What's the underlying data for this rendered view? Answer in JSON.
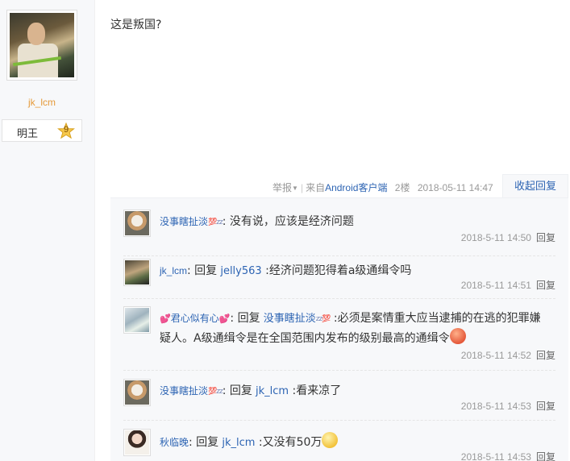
{
  "author": {
    "avatar_icon": "avatar-warrior",
    "name": "jk_lcm",
    "rank_title": "明王",
    "level": "9",
    "name_color": "#e59a3a"
  },
  "post": {
    "content": "这是叛国?"
  },
  "tail": {
    "report_label": "举报",
    "source_prefix": "来自",
    "source_link": "Android客户端",
    "floor": "2楼",
    "time": "2018-05-11 14:47",
    "collapse_label": "收起回复"
  },
  "replies": [
    {
      "user": "没事瞎扯淡",
      "user_badges": [
        "💯",
        "zz"
      ],
      "avatar_icon": "cat-avatar",
      "segments": [
        {
          "type": "text",
          "value": ": 没有说，应该是经济问题"
        }
      ],
      "time": "2018-5-11 14:50",
      "reply_label": "回复"
    },
    {
      "user": "jk_lcm",
      "avatar_icon": "warrior-avatar",
      "prefix": ": 回复",
      "mention": "jelly563",
      "body": " :经济问题犯得着a级通缉令吗",
      "time": "2018-5-11 14:51",
      "reply_label": "回复"
    },
    {
      "user": "君心似有心",
      "avatar_icon": "girl-avatar",
      "prefix": ": 回复",
      "mention": "没事瞎扯淡",
      "body_line1": " :必须是案情重大应当逮捕的在逃的犯罪嫌",
      "body_line2": "疑人。A级通缉令是在全国范围内发布的级别最高的通缉令",
      "time": "2018-5-11 14:52",
      "reply_label": "回复"
    },
    {
      "user": "没事瞎扯淡",
      "avatar_icon": "cat-avatar",
      "prefix": ": 回复",
      "mention": "jk_lcm",
      "body": " :看来凉了",
      "time": "2018-5-11 14:53",
      "reply_label": "回复"
    },
    {
      "user": "秋临晚",
      "avatar_icon": "lady-avatar",
      "prefix": ": 回复",
      "mention": "jk_lcm",
      "body": " :又没有50万",
      "time": "2018-5-11 14:53",
      "reply_label": "回复"
    }
  ],
  "colors": {
    "link": "#2d64b3",
    "meta": "#999999",
    "panel_bg": "#f7f8fa"
  }
}
